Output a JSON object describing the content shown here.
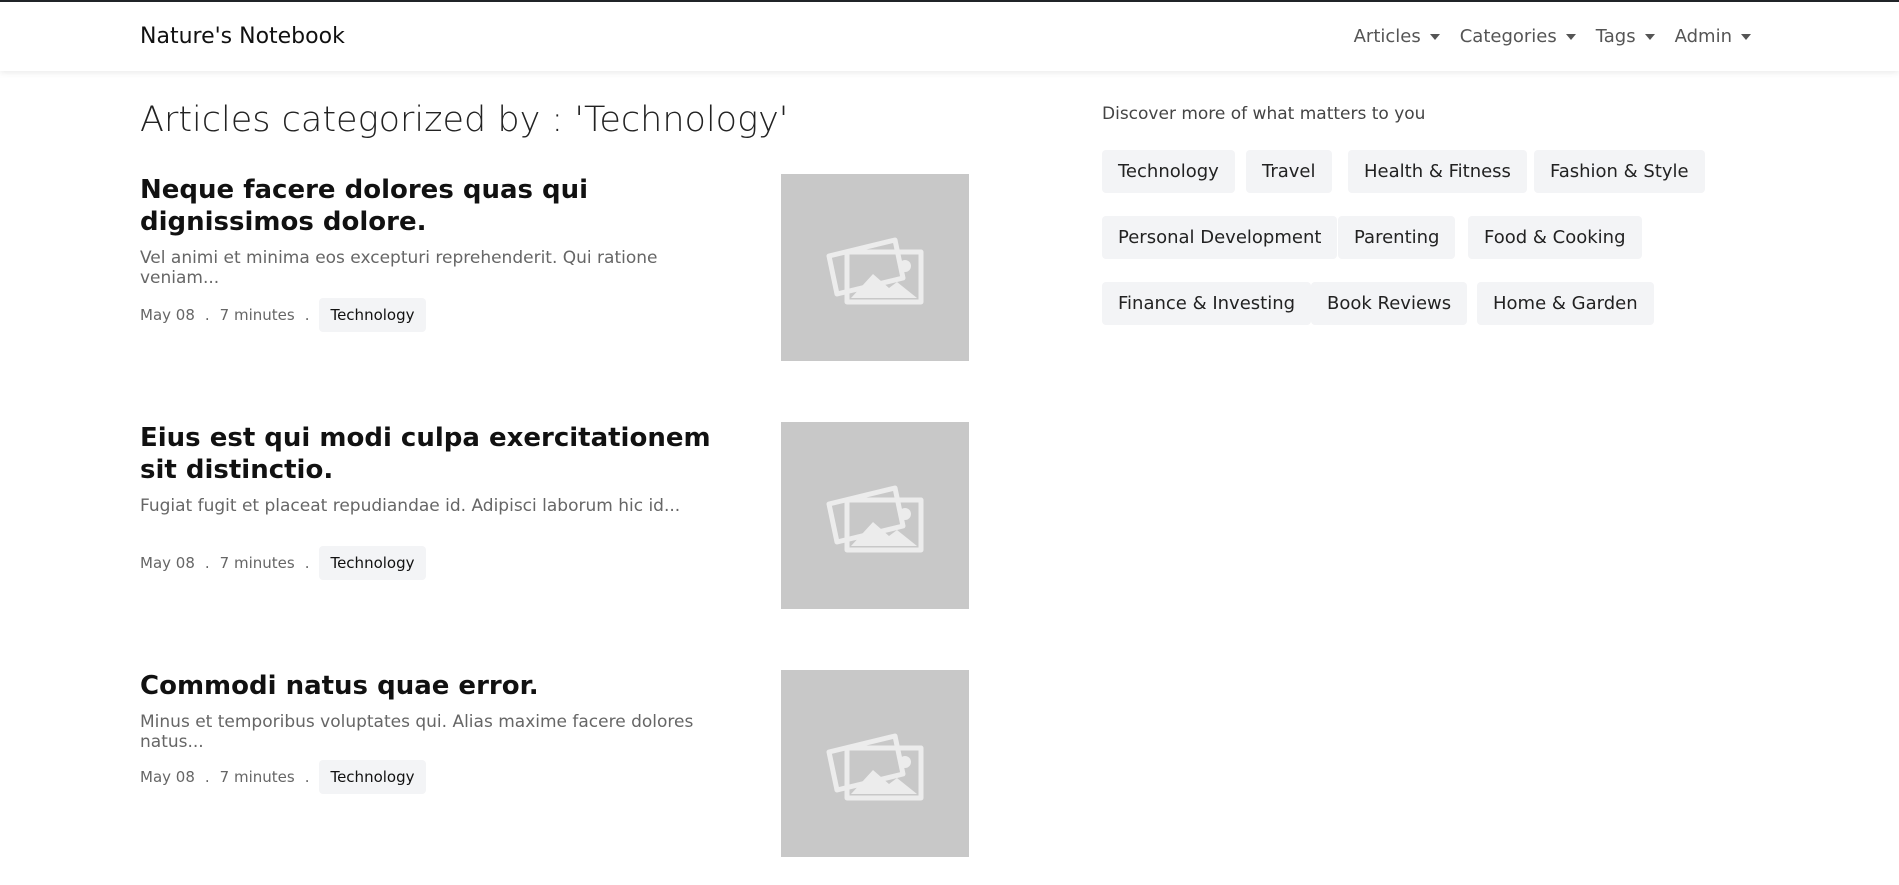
{
  "navbar": {
    "brand": "Nature's Notebook",
    "menu": [
      {
        "label": "Articles"
      },
      {
        "label": "Categories"
      },
      {
        "label": "Tags"
      },
      {
        "label": "Admin"
      }
    ]
  },
  "main": {
    "title": "Articles categorized by : 'Technology'",
    "articles": [
      {
        "title": "Neque facere dolores quas qui dignissimos dolore.",
        "excerpt": "Vel animi et minima eos excepturi reprehenderit. Qui ratione veniam...",
        "date": "May 08",
        "read_time": "7 minutes",
        "category": "Technology"
      },
      {
        "title": "Eius est qui modi culpa exercitationem sit distinctio.",
        "excerpt": "Fugiat fugit et placeat repudiandae id. Adipisci laborum hic id...",
        "date": "May 08",
        "read_time": "7 minutes",
        "category": "Technology"
      },
      {
        "title": "Commodi natus quae error.",
        "excerpt": "Minus et temporibus voluptates qui. Alias maxime facere dolores natus...",
        "date": "May 08",
        "read_time": "7 minutes",
        "category": "Technology"
      }
    ],
    "meta_separator": "."
  },
  "sidebar": {
    "heading": "Discover more of what matters to you",
    "categories": [
      "Technology",
      "Travel",
      "Health & Fitness",
      "Fashion & Style",
      "Personal Development",
      "Parenting",
      "Food & Cooking",
      "Finance & Investing",
      "Book Reviews",
      "Home & Garden"
    ]
  },
  "icons": {
    "thumbnail": "image-placeholder-icon",
    "dropdown": "caret-down-icon"
  },
  "colors": {
    "placeholder_bg": "#c8c8c8",
    "pill_bg": "#f3f4f6",
    "topline": "#212529"
  }
}
